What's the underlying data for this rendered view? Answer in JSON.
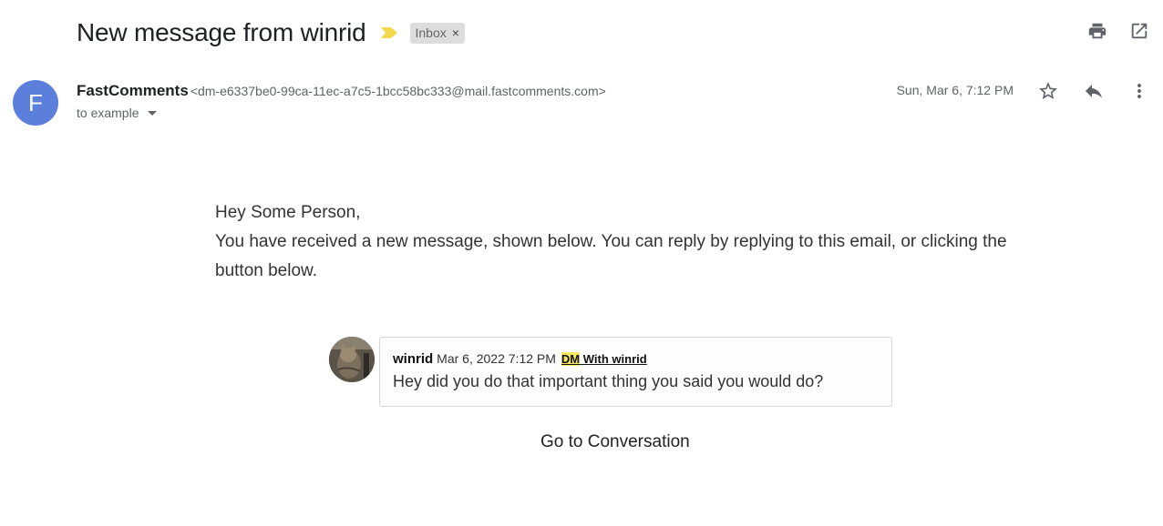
{
  "header": {
    "subject": "New message from winrid",
    "label": "Inbox",
    "label_remove": "×",
    "icons": [
      "print-icon",
      "open-in-new-window-icon"
    ]
  },
  "sender": {
    "avatar_letter": "F",
    "name": "FastComments",
    "email": "<dm-e6337be0-99ca-11ec-a7c5-1bcc58bc333@mail.fastcomments.com>",
    "to": "to example",
    "date": "Sun, Mar 6, 7:12 PM",
    "icons": [
      "star-icon",
      "reply-icon",
      "more-vert-icon"
    ]
  },
  "body": {
    "greeting": "Hey Some Person,",
    "intro": "You have received a new message, shown below. You can reply by replying to this email, or clicking the button below."
  },
  "comment": {
    "user": "winrid",
    "date": "Mar 6, 2022 7:12 PM",
    "dm_prefix": "DM",
    "dm_suffix": " With winrid",
    "text": "Hey did you do that important thing you said you would do?"
  },
  "cta": {
    "label": "Go to Conversation"
  },
  "colors": {
    "avatar_bg": "#5c7fdb",
    "importance_marker": "#f2d94e",
    "dm_highlight": "#f5e663"
  }
}
